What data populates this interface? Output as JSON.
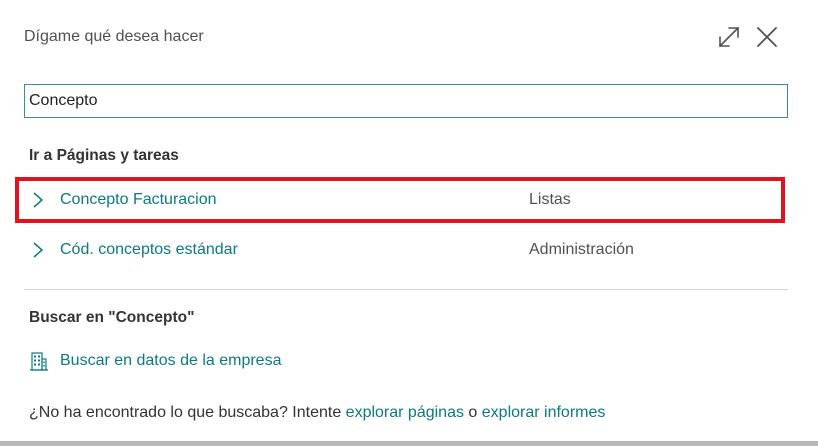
{
  "dialog": {
    "title": "Dígame qué desea hacer",
    "icons": {
      "expand": "expand-icon",
      "close": "close-icon"
    }
  },
  "search": {
    "value": "Concepto",
    "placeholder": ""
  },
  "pages_section": {
    "title": "Ir a Páginas y tareas",
    "results": [
      {
        "name": "Concepto Facturacion",
        "category": "Listas",
        "highlighted": true
      },
      {
        "name": "Cód. conceptos estándar",
        "category": "Administración",
        "highlighted": false
      }
    ]
  },
  "search_section": {
    "title": "Buscar en \"Concepto\"",
    "company_link": {
      "label": "Buscar en datos de la empresa",
      "icon": "building-icon"
    }
  },
  "footer": {
    "prefix": "¿No ha encontrado lo que buscaba? Intente ",
    "link_pages": "explorar páginas",
    "middle": " o ",
    "link_reports": "explorar informes"
  },
  "colors": {
    "accent": "#0b7a80",
    "highlight_border": "#e0141e",
    "input_border": "#3a8c96"
  }
}
